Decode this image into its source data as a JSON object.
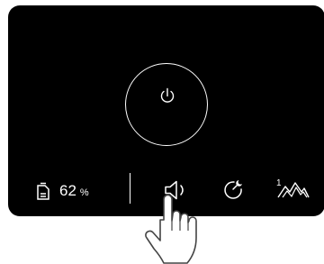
{
  "panel": {
    "power_button_icon": "power-icon",
    "status": {
      "icon": "water-tank-icon",
      "value": "62",
      "unit": "%"
    },
    "controls": [
      {
        "name": "sound",
        "icon": "speaker-icon"
      },
      {
        "name": "timer",
        "icon": "timer-moon-icon"
      },
      {
        "name": "mode",
        "icon": "mountain-mode-icon",
        "badge": "1"
      }
    ],
    "gesture": {
      "icon": "hand-pointer-icon",
      "target": "sound"
    }
  },
  "colors": {
    "panel_bg": "#000000",
    "foreground": "#ffffff",
    "page_bg": "#ffffff"
  }
}
